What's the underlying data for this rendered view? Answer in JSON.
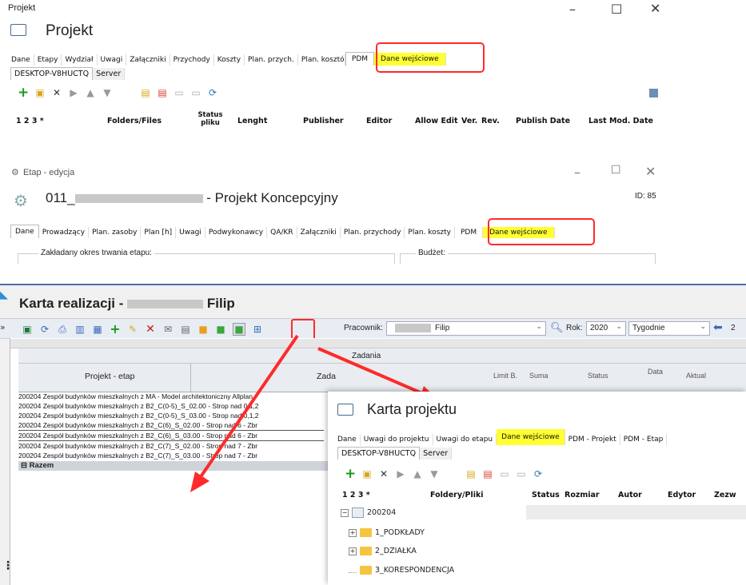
{
  "win1": {
    "titlebar": "Projekt",
    "title": "Projekt",
    "tabs": [
      "Dane",
      "Etapy",
      "Wydział",
      "Uwagi",
      "Załączniki",
      "Przychody",
      "Koszty",
      "Plan. przych.",
      "Plan. kosztów",
      "PDM",
      "Dane wejściowe"
    ],
    "subtabs": [
      "DESKTOP-V8HUCTQ",
      "Server"
    ],
    "columns": [
      "1 2 3 *",
      "Folders/Files",
      "Status pliku",
      "Lenght",
      "Publisher",
      "Editor",
      "Allow Edit",
      "Ver.",
      "Rev.",
      "Publish Date",
      "Last Mod. Date"
    ]
  },
  "win2": {
    "titlebar": "Etap - edycja",
    "title_prefix": "011_",
    "title_suffix": " - Projekt Koncepcyjny",
    "id_label": "ID: 85",
    "tabs": [
      "Dane",
      "Prowadzący",
      "Plan. zasoby",
      "Plan [h]",
      "Uwagi",
      "Podwykonawcy",
      "QA/KR",
      "Załączniki",
      "Plan. przychody",
      "Plan. koszty",
      "PDM",
      "Dane wejściowe"
    ],
    "group_period": "Zakładany okres trwania etapu:",
    "group_budget": "Budżet:"
  },
  "win3": {
    "title_prefix": "Karta realizacji -",
    "title_suffix": "Filip",
    "worker_label": "Pracownik:",
    "worker_value": "Filip",
    "year_label": "Rok:",
    "year_value": "2020",
    "period_value": "Tygodnie",
    "arrow_value": "2",
    "section_header": "Zadania",
    "col_project": "Projekt - etap",
    "col_task": "Zada",
    "col_limit": "Limit B.",
    "col_sum": "Suma",
    "col_status": "Status",
    "col_date": "Data",
    "col_other": "Aktual",
    "rows": [
      [
        "200204  Zespół budynków mieszkalnych z",
        "MA - Model architektoniczny Allplan"
      ],
      [
        "200204  Zespół budynków mieszkalnych z",
        "B2_C(0-5)_S_02.00 - Strop nad 0,1,2"
      ],
      [
        "200204  Zespół budynków mieszkalnych z",
        "B2_C(0-5)_S_03.00 - Strop nad 0,1,2"
      ],
      [
        "200204  Zespół budynków mieszkalnych z",
        "B2_C(6)_S_02.00 - Strop nad 6 - Zbr"
      ],
      [
        "200204  Zespół budynków mieszkalnych z",
        "B2_C(6)_S_03.00 - Strop nad 6 - Zbr"
      ],
      [
        "200204  Zespół budynków mieszkalnych z",
        "B2_C(7)_S_02.00 - Strop nad 7 - Zbr"
      ],
      [
        "200204  Zespół budynków mieszkalnych z",
        "B2_C(7)_S_03.00 - Strop nad 7 - Zbr"
      ]
    ],
    "total_label": "Razem"
  },
  "win4": {
    "title": "Karta projektu",
    "tabs": [
      "Dane",
      "Uwagi do projektu",
      "Uwagi do etapu",
      "Dane wejściowe",
      "PDM - Projekt",
      "PDM - Etap"
    ],
    "subtabs": [
      "DESKTOP-V8HUCTQ",
      "Server"
    ],
    "columns": [
      "1 2 3 *",
      "Foldery/Pliki",
      "Status",
      "Rozmiar",
      "Autor",
      "Edytor",
      "Zezw"
    ],
    "root": "200204",
    "folders": [
      "1_PODKŁADY",
      "2_DZIAŁKA",
      "3_KORESPONDENCJA"
    ]
  },
  "colors": {
    "highlight": "#ffff33",
    "annotation": "#ff2a2a"
  }
}
